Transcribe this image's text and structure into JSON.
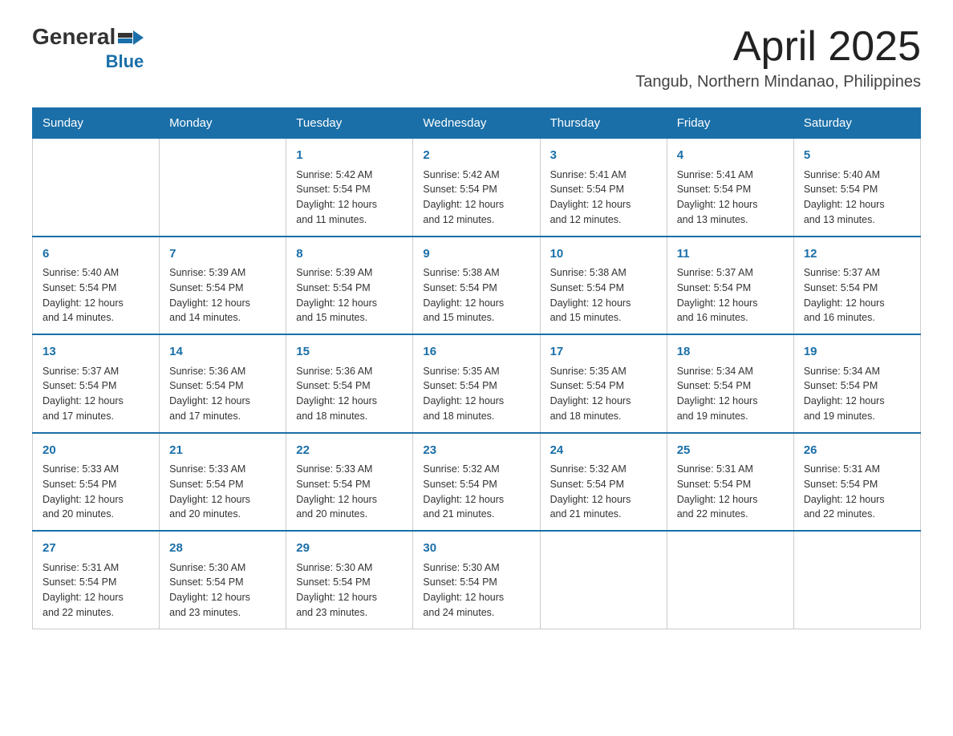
{
  "header": {
    "logo_general": "General",
    "logo_blue": "Blue",
    "month_title": "April 2025",
    "location": "Tangub, Northern Mindanao, Philippines"
  },
  "calendar": {
    "days_of_week": [
      "Sunday",
      "Monday",
      "Tuesday",
      "Wednesday",
      "Thursday",
      "Friday",
      "Saturday"
    ],
    "weeks": [
      [
        {
          "day": "",
          "info": ""
        },
        {
          "day": "",
          "info": ""
        },
        {
          "day": "1",
          "info": "Sunrise: 5:42 AM\nSunset: 5:54 PM\nDaylight: 12 hours\nand 11 minutes."
        },
        {
          "day": "2",
          "info": "Sunrise: 5:42 AM\nSunset: 5:54 PM\nDaylight: 12 hours\nand 12 minutes."
        },
        {
          "day": "3",
          "info": "Sunrise: 5:41 AM\nSunset: 5:54 PM\nDaylight: 12 hours\nand 12 minutes."
        },
        {
          "day": "4",
          "info": "Sunrise: 5:41 AM\nSunset: 5:54 PM\nDaylight: 12 hours\nand 13 minutes."
        },
        {
          "day": "5",
          "info": "Sunrise: 5:40 AM\nSunset: 5:54 PM\nDaylight: 12 hours\nand 13 minutes."
        }
      ],
      [
        {
          "day": "6",
          "info": "Sunrise: 5:40 AM\nSunset: 5:54 PM\nDaylight: 12 hours\nand 14 minutes."
        },
        {
          "day": "7",
          "info": "Sunrise: 5:39 AM\nSunset: 5:54 PM\nDaylight: 12 hours\nand 14 minutes."
        },
        {
          "day": "8",
          "info": "Sunrise: 5:39 AM\nSunset: 5:54 PM\nDaylight: 12 hours\nand 15 minutes."
        },
        {
          "day": "9",
          "info": "Sunrise: 5:38 AM\nSunset: 5:54 PM\nDaylight: 12 hours\nand 15 minutes."
        },
        {
          "day": "10",
          "info": "Sunrise: 5:38 AM\nSunset: 5:54 PM\nDaylight: 12 hours\nand 15 minutes."
        },
        {
          "day": "11",
          "info": "Sunrise: 5:37 AM\nSunset: 5:54 PM\nDaylight: 12 hours\nand 16 minutes."
        },
        {
          "day": "12",
          "info": "Sunrise: 5:37 AM\nSunset: 5:54 PM\nDaylight: 12 hours\nand 16 minutes."
        }
      ],
      [
        {
          "day": "13",
          "info": "Sunrise: 5:37 AM\nSunset: 5:54 PM\nDaylight: 12 hours\nand 17 minutes."
        },
        {
          "day": "14",
          "info": "Sunrise: 5:36 AM\nSunset: 5:54 PM\nDaylight: 12 hours\nand 17 minutes."
        },
        {
          "day": "15",
          "info": "Sunrise: 5:36 AM\nSunset: 5:54 PM\nDaylight: 12 hours\nand 18 minutes."
        },
        {
          "day": "16",
          "info": "Sunrise: 5:35 AM\nSunset: 5:54 PM\nDaylight: 12 hours\nand 18 minutes."
        },
        {
          "day": "17",
          "info": "Sunrise: 5:35 AM\nSunset: 5:54 PM\nDaylight: 12 hours\nand 18 minutes."
        },
        {
          "day": "18",
          "info": "Sunrise: 5:34 AM\nSunset: 5:54 PM\nDaylight: 12 hours\nand 19 minutes."
        },
        {
          "day": "19",
          "info": "Sunrise: 5:34 AM\nSunset: 5:54 PM\nDaylight: 12 hours\nand 19 minutes."
        }
      ],
      [
        {
          "day": "20",
          "info": "Sunrise: 5:33 AM\nSunset: 5:54 PM\nDaylight: 12 hours\nand 20 minutes."
        },
        {
          "day": "21",
          "info": "Sunrise: 5:33 AM\nSunset: 5:54 PM\nDaylight: 12 hours\nand 20 minutes."
        },
        {
          "day": "22",
          "info": "Sunrise: 5:33 AM\nSunset: 5:54 PM\nDaylight: 12 hours\nand 20 minutes."
        },
        {
          "day": "23",
          "info": "Sunrise: 5:32 AM\nSunset: 5:54 PM\nDaylight: 12 hours\nand 21 minutes."
        },
        {
          "day": "24",
          "info": "Sunrise: 5:32 AM\nSunset: 5:54 PM\nDaylight: 12 hours\nand 21 minutes."
        },
        {
          "day": "25",
          "info": "Sunrise: 5:31 AM\nSunset: 5:54 PM\nDaylight: 12 hours\nand 22 minutes."
        },
        {
          "day": "26",
          "info": "Sunrise: 5:31 AM\nSunset: 5:54 PM\nDaylight: 12 hours\nand 22 minutes."
        }
      ],
      [
        {
          "day": "27",
          "info": "Sunrise: 5:31 AM\nSunset: 5:54 PM\nDaylight: 12 hours\nand 22 minutes."
        },
        {
          "day": "28",
          "info": "Sunrise: 5:30 AM\nSunset: 5:54 PM\nDaylight: 12 hours\nand 23 minutes."
        },
        {
          "day": "29",
          "info": "Sunrise: 5:30 AM\nSunset: 5:54 PM\nDaylight: 12 hours\nand 23 minutes."
        },
        {
          "day": "30",
          "info": "Sunrise: 5:30 AM\nSunset: 5:54 PM\nDaylight: 12 hours\nand 24 minutes."
        },
        {
          "day": "",
          "info": ""
        },
        {
          "day": "",
          "info": ""
        },
        {
          "day": "",
          "info": ""
        }
      ]
    ]
  }
}
